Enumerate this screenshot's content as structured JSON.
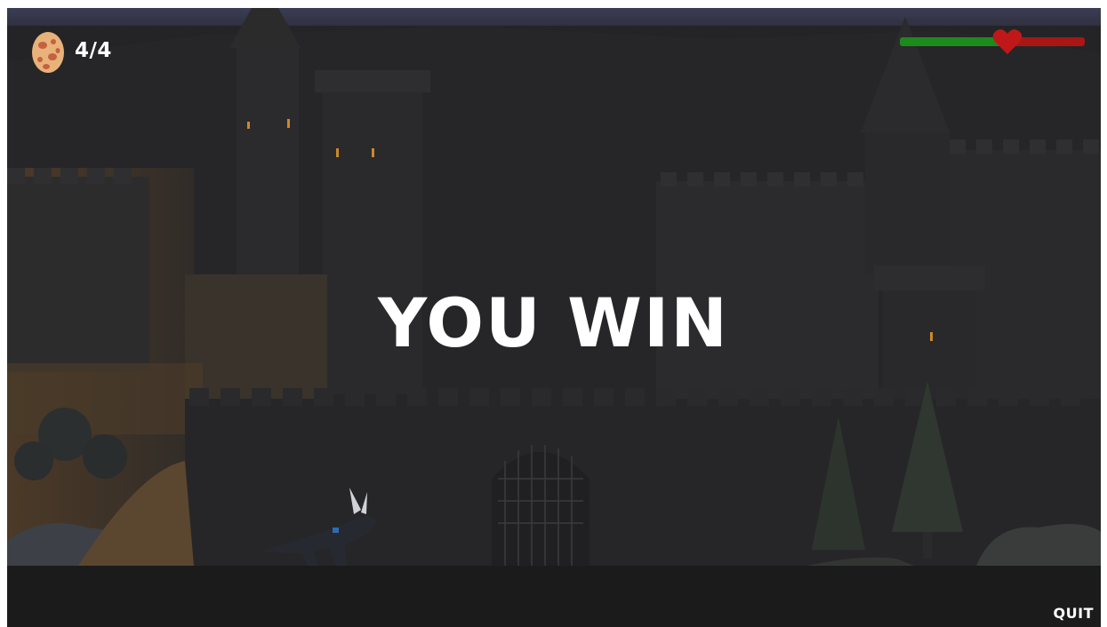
{
  "hud": {
    "egg_icon": "egg-icon",
    "egg_count": "4/4",
    "health": {
      "fraction": 0.58,
      "fill_color": "#1c8a1c",
      "empty_color": "#a81616",
      "heart_icon": "heart-icon",
      "heart_color": "#c01818"
    }
  },
  "overlay": {
    "title": "YOU WIN"
  },
  "menu": {
    "quit_label": "QUIT"
  },
  "scene": {
    "description_icons": [
      "castle",
      "pine-tree",
      "dragon-character"
    ],
    "sky_color": "#3b3d55",
    "tint_color": "#1f1f21"
  }
}
